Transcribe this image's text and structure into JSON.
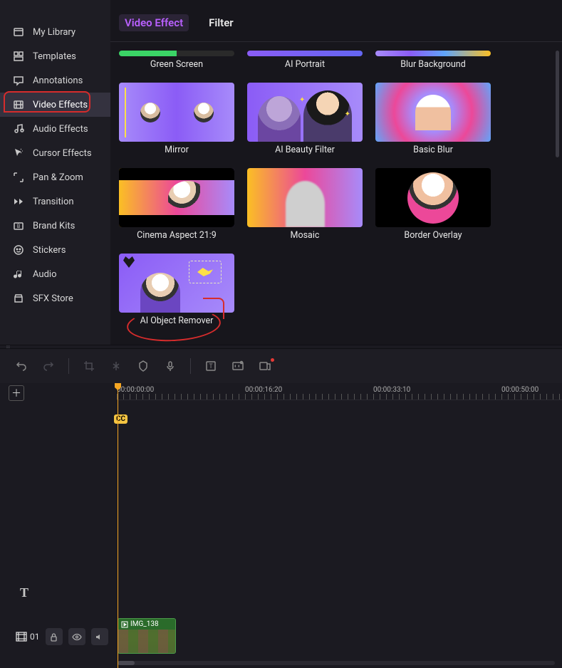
{
  "sidebar": {
    "items": [
      {
        "label": "My Library",
        "icon": "library"
      },
      {
        "label": "Templates",
        "icon": "templates"
      },
      {
        "label": "Annotations",
        "icon": "annotations"
      },
      {
        "label": "Video Effects",
        "icon": "video-effects",
        "active": true
      },
      {
        "label": "Audio Effects",
        "icon": "audio-effects"
      },
      {
        "label": "Cursor Effects",
        "icon": "cursor-effects"
      },
      {
        "label": "Pan & Zoom",
        "icon": "pan-zoom"
      },
      {
        "label": "Transition",
        "icon": "transition"
      },
      {
        "label": "Brand Kits",
        "icon": "brand-kits"
      },
      {
        "label": "Stickers",
        "icon": "stickers"
      },
      {
        "label": "Audio",
        "icon": "audio"
      },
      {
        "label": "SFX Store",
        "icon": "sfx-store"
      }
    ]
  },
  "tabs": {
    "video_effect": "Video Effect",
    "filter": "Filter"
  },
  "effects": {
    "row0": [
      {
        "label": "Green Screen"
      },
      {
        "label": "AI Portrait"
      },
      {
        "label": "Blur Background"
      }
    ],
    "row1": [
      {
        "label": "Mirror"
      },
      {
        "label": "AI Beauty Filter"
      },
      {
        "label": "Basic Blur"
      }
    ],
    "row2": [
      {
        "label": "Cinema Aspect 21:9"
      },
      {
        "label": "Mosaic"
      },
      {
        "label": "Border Overlay"
      }
    ],
    "row3": [
      {
        "label": "AI Object Remover"
      }
    ]
  },
  "timeline": {
    "ruler": [
      "00:00:00:00",
      "00:00:16:20",
      "00:00:33:10",
      "00:00:50:00"
    ],
    "cc_badge": "CC",
    "text_track_label": "T",
    "track_count": "01",
    "clip_label": "IMG_138"
  },
  "annotations": {
    "sidebar_highlight": "Video Effects",
    "effect_highlight": "AI Object Remover"
  }
}
